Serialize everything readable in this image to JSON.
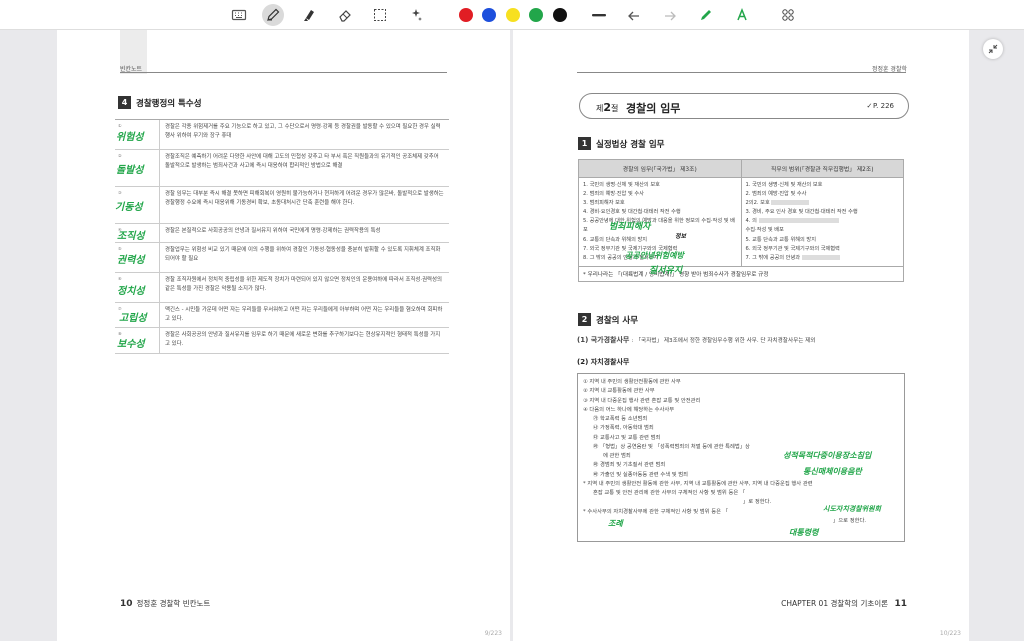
{
  "toolbar": {
    "tools": [
      "keyboard-icon",
      "pen-icon",
      "highlighter-icon",
      "eraser-icon",
      "lasso-select-icon",
      "magic-icon",
      "line-width-icon",
      "undo-icon",
      "redo-icon",
      "pen-tip-icon",
      "ai-ink-icon",
      "grid-icon"
    ],
    "colors": [
      "#e11d24",
      "#1d4fdc",
      "#f7e020",
      "#22a64a",
      "#111111"
    ]
  },
  "left_page": {
    "running_head": "빈칸노트",
    "section_num": "4",
    "section_title": "경찰행정의 특수성",
    "rows": [
      {
        "tag": "①",
        "hw": "위험성",
        "text": "경찰은 각종 위험제거를 주요 기능으로 하고 있고, 그 수단으로서 명령·강제 등 경찰권을 발동할 수 있으며 필요한 경우 실력행사 위하여 무기와 장구 휴대"
      },
      {
        "tag": "②",
        "hw": "돌발성",
        "text": "경찰조직은 예측하기 어려운 다양한 사안에 대해 고도의 민첩성 갖추고 타 부서 혹은 직원들과의 유기적인 공조체제 갖추어 돌발적으로 발생하는 범죄사건과 사고에 즉시 대응하여 합리적인 방법으로 해결"
      },
      {
        "tag": "③",
        "hw": "기동성",
        "text": "경찰 임무는 대부분 즉시 해결 못하면 피해회복이 영원히 불가능하거나 현저하게 어려운 경우가 많은바, 돌발적으로 발생하는 경찰행정 수요에 즉시 대응위해 기동경비 확보, 초동대처시간 단축 훈련을 해야 한다."
      },
      {
        "tag": "④",
        "hw": "조직성",
        "text": "경찰은 본질적으로 사회공공의 안녕과 질서유지 위하여 국민에게 명령·강제하는 권력작용의 특성"
      },
      {
        "tag": "⑤",
        "hw": "권력성",
        "text": "경찰업무는 위험성 비교 있기 때문에 이의 수행을 위하여 경찰인 기동성·협동성을 충분히 발휘할 수 있도록 지휘체계 조직화되어야 할 필요"
      },
      {
        "tag": "⑥",
        "hw": "정치성",
        "text": "경찰 조직자원에서 정치적 중립성을 위한 제도적 장치가 마련되어 있지 않으면 정치인의 운용여하에 따라서 조직성·권력성의 같은 특성을 가진 경찰은 악용될 소지가 많다."
      },
      {
        "tag": "⑦",
        "hw": "고립성",
        "text": "맥긴스 - 시민들 가운데 어떤 자는 우리들을 무서워하고 어떤 자는 우리들에게 아부하며 어떤 자는 우리들을 혐오하며 회피하고 있다."
      },
      {
        "tag": "⑧",
        "hw": "보수성",
        "text": "경찰은 사회공공의 안녕과 질서유지를 임무로 하기 때문에 새로운 변화를 추구하기보다는 현상유지적인 형태적 특성을 가지고 있다."
      }
    ],
    "footer_num": "10",
    "footer_text": "정정훈 경찰학 빈칸노트",
    "page_counter": "9/223"
  },
  "right_page": {
    "running_head": "정정훈 경찰학",
    "chapter_num_pre": "제",
    "chapter_num": "2",
    "chapter_num_post": "절",
    "chapter_title": "경찰의 임무",
    "page_ref": "P. 226",
    "section1_num": "1",
    "section1_title": "실정법상 경찰 임무",
    "table_headers": [
      "경찰의 임무(「국가법」 제3조)",
      "직무의 범위(「경찰관 직무집행법」 제2조)"
    ],
    "left_col": [
      "1. 국민의 생명·신체 및 재산의 보호",
      "2. 범죄의 예방·진압 및 수사",
      "3. 범죄피해자 보호",
      "4. 경비·요인경호 및 대간첩·대테러 작전 수행",
      "5. 공공안녕에 대한 위험의 예방과 대응을 위한 정보의 수집·작성 및 배포",
      "6. 교통의 단속과 위해의 방지",
      "7. 외국 정부기관 및 국제기구와의 국제협력",
      "8. 그 밖의 공공의 안녕과 질서유지"
    ],
    "right_col": [
      "1. 국민의 생명·신체 및 재산의 보호",
      "2. 범죄의 예방·진압 및 수사",
      "2의2. 보호",
      "3. 경비, 주요 인사 경호 및 대간첩·대테러 작전 수행",
      "4. 의",
      "수집·작성 및 배포",
      "5. 교통 단속과 교통 위해의 방지",
      "6. 외국 정부기관 및 국제기구와의 국제협력",
      "7. 그 밖에 공공의 안녕과"
    ],
    "table_note": "* 우리나라는 「(대륙법계 / 영미법계)」 영향 받아 범죄수사가 경찰임무로 규정",
    "hw_table_1": "공공안녕위험예방",
    "hw_table_2": "정보",
    "hw_table_3": "질서유지",
    "hw_table_4": "범죄피해자",
    "section2_num": "2",
    "section2_title": "경찰의 사무",
    "sub1_label": "(1) 국가경찰사무",
    "sub1_text": ": 「국자법」 제3조에서 정한 경찰임무수행 위한 사무. 단 자치경찰사무는 제외",
    "sub2_label": "(2) 자치경찰사무",
    "box_lines": [
      "① 지역 내 주민의 생활안전활동에 관한 사무",
      "② 지역 내 교통활동에 관한 사무",
      "③ 지역 내 다중운집 행사 관련 혼잡 교통 및 안전관리",
      "④ 다음의 어느 하나에 해당하는 수사사무",
      "㉮ 학교폭력 등 소년범죄",
      "㉯ 가정폭력, 아동학대 범죄",
      "㉰ 교통사고 및 교통 관련 범죄",
      "㉱ 「형법」상 공연음란 및 「성폭력범죄의 처벌 등에 관한 특례법」상",
      "에 관한 범죄",
      "㉲ 경범죄 및 기초질서 관련 범죄",
      "㉳ 가출인 및 실종아동등 관련 수색 및 범죄",
      "* 지역 내 주민의 생활안전 활동에 관한 사무, 지역 내 교통활동에 관한 사무, 지역 내 다중운집 행사 관련",
      "혼잡 교통 및 안전 관리에 관한 사무의 구체적인 사항 및 범위 등은 「",
      "」로 정한다.",
      "* 수사사무의 자치경찰사무에 관한 구체적인 사항 및 범위 등은 「",
      "」으로 정한다."
    ],
    "hw_box_1": "성적목적다중이용장소침입",
    "hw_box_2": "통신매체이용음란",
    "hw_box_3": "시도자치경찰위원회",
    "hw_box_4": "조례",
    "hw_box_5": "대통령령",
    "footer_text": "CHAPTER 01 경찰학의 기초이론",
    "footer_num": "11",
    "page_counter": "10/223"
  },
  "side": {
    "pin_icon": "collapse-icon"
  }
}
